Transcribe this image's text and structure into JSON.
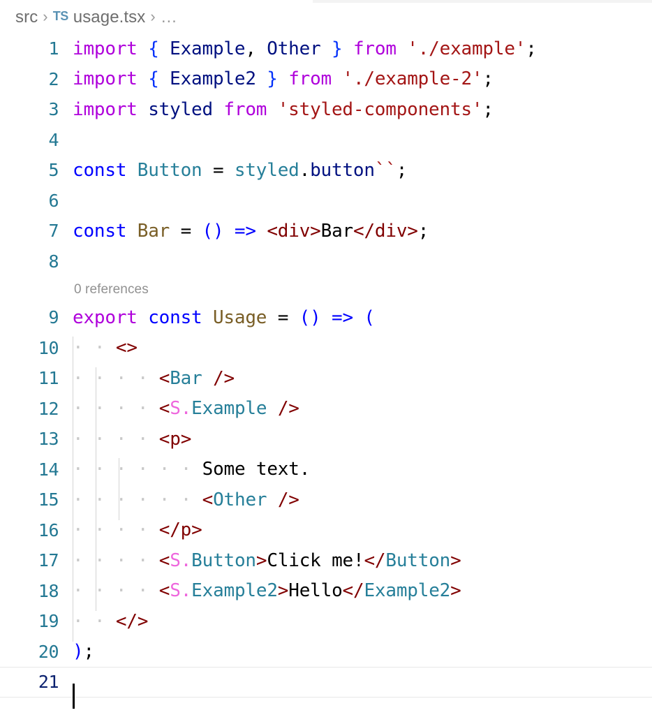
{
  "window": {
    "background": "#ffffff",
    "theme": "light"
  },
  "breadcrumb": {
    "folder": "src",
    "separator": "›",
    "file_icon_label": "TS",
    "file": "usage.tsx",
    "overflow": "…"
  },
  "colors": {
    "keyword_purple": "#af00db",
    "keyword_blue": "#0000ff",
    "identifier": "#001080",
    "type": "#267f99",
    "function": "#795e26",
    "string": "#a31515",
    "tag": "#800000",
    "pink_namespace": "#ee66dd",
    "line_number": "#237893",
    "line_number_active": "#0b216f",
    "codelens": "#919191",
    "indent_guide": "#d3d3d3",
    "whitespace_dot": "#c0c0c0"
  },
  "editor": {
    "language": "typescriptreact",
    "cursor_line": 21,
    "codelens": {
      "line": 9,
      "text": "0 references"
    },
    "line_numbers": [
      "1",
      "2",
      "3",
      "4",
      "5",
      "6",
      "7",
      "8",
      "9",
      "10",
      "11",
      "12",
      "13",
      "14",
      "15",
      "16",
      "17",
      "18",
      "19",
      "20",
      "21"
    ],
    "lines": [
      {
        "n": "1",
        "text": "import { Example, Other } from './example';"
      },
      {
        "n": "2",
        "text": "import { Example2 } from './example-2';"
      },
      {
        "n": "3",
        "text": "import styled from 'styled-components';"
      },
      {
        "n": "4",
        "text": ""
      },
      {
        "n": "5",
        "text": "const Button = styled.button``;"
      },
      {
        "n": "6",
        "text": ""
      },
      {
        "n": "7",
        "text": "const Bar = () => <div>Bar</div>;"
      },
      {
        "n": "8",
        "text": ""
      },
      {
        "n": "9",
        "text": "export const Usage = () => ("
      },
      {
        "n": "10",
        "text": "  <>"
      },
      {
        "n": "11",
        "text": "    <Bar />"
      },
      {
        "n": "12",
        "text": "    <S.Example />"
      },
      {
        "n": "13",
        "text": "    <p>"
      },
      {
        "n": "14",
        "text": "      Some text."
      },
      {
        "n": "15",
        "text": "      <Other />"
      },
      {
        "n": "16",
        "text": "    </p>"
      },
      {
        "n": "17",
        "text": "    <S.Button>Click me!</Button>"
      },
      {
        "n": "18",
        "text": "    <S.Example2>Hello</Example2>"
      },
      {
        "n": "19",
        "text": "  </>"
      },
      {
        "n": "20",
        "text": ");"
      },
      {
        "n": "21",
        "text": ""
      }
    ],
    "tokens": {
      "import": "import",
      "from": "from",
      "export": "export",
      "const": "const",
      "brace_open": "{",
      "brace_close": "}",
      "comma": ",",
      "semicolon": ";",
      "equals": "=",
      "arrow": "=>",
      "paren_open": "(",
      "paren_close": ")",
      "parens": "()",
      "dot": ".",
      "backticks": "``",
      "name_Example": "Example",
      "name_Other": "Other",
      "name_Example2": "Example2",
      "name_styled": "styled",
      "name_Button": "Button",
      "name_button": "button",
      "name_Bar": "Bar",
      "name_Usage": "Usage",
      "name_S": "S",
      "name_p": "p",
      "name_div": "div",
      "str_example": "'./example'",
      "str_example2": "'./example-2'",
      "str_styled_components": "'styled-components'",
      "lt": "<",
      "gt": ">",
      "lt_slash": "</",
      "slash_gt": "/>",
      "fragment_open": "<>",
      "fragment_close": "</>",
      "text_Bar": "Bar",
      "text_some": "Some text.",
      "text_click": "Click me!",
      "text_hello": "Hello",
      "ws_dot": "·"
    }
  }
}
